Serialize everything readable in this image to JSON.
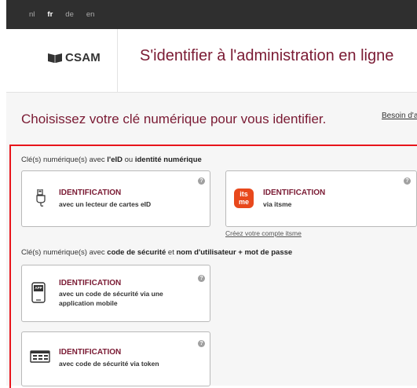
{
  "languages": [
    {
      "code": "nl",
      "active": false
    },
    {
      "code": "fr",
      "active": true
    },
    {
      "code": "de",
      "active": false
    },
    {
      "code": "en",
      "active": false
    }
  ],
  "header": {
    "logo_text": "CSAM",
    "title": "S'identifier à l'administration en ligne"
  },
  "main": {
    "heading": "Choisissez votre clé numérique pour vous identifier.",
    "help_link": "Besoin d'aide?",
    "section1": {
      "prefix": "Clé(s) numérique(s) avec ",
      "bold1": "l'eID",
      "mid": " ou ",
      "bold2": "identité numérique"
    },
    "section2": {
      "prefix": "Clé(s) numérique(s) avec ",
      "bold1": "code de sécurité",
      "mid": " et ",
      "bold2": "nom d'utilisateur + mot de passe"
    },
    "cards": [
      {
        "title": "IDENTIFICATION",
        "subtitle": "avec un lecteur de cartes eID",
        "icon": "card-reader-icon"
      },
      {
        "title": "IDENTIFICATION",
        "subtitle": "via itsme",
        "icon": "itsme-logo-icon",
        "icon_text_top": "its",
        "icon_text_bottom": "me"
      },
      {
        "title": "IDENTIFICATION",
        "subtitle": "avec un code de sécurité via une application mobile",
        "icon": "mobile-app-icon",
        "icon_text": "APP"
      },
      {
        "title": "IDENTIFICATION",
        "subtitle": "avec code de sécurité via token",
        "icon": "token-icon"
      }
    ],
    "help_icon_glyph": "?",
    "itsme_link": "Créez votre compte itsme"
  },
  "colors": {
    "accent": "#7a1a33",
    "itsme": "#e8481c",
    "highlight": "#e8141b",
    "topbar": "#2f2f2f"
  }
}
